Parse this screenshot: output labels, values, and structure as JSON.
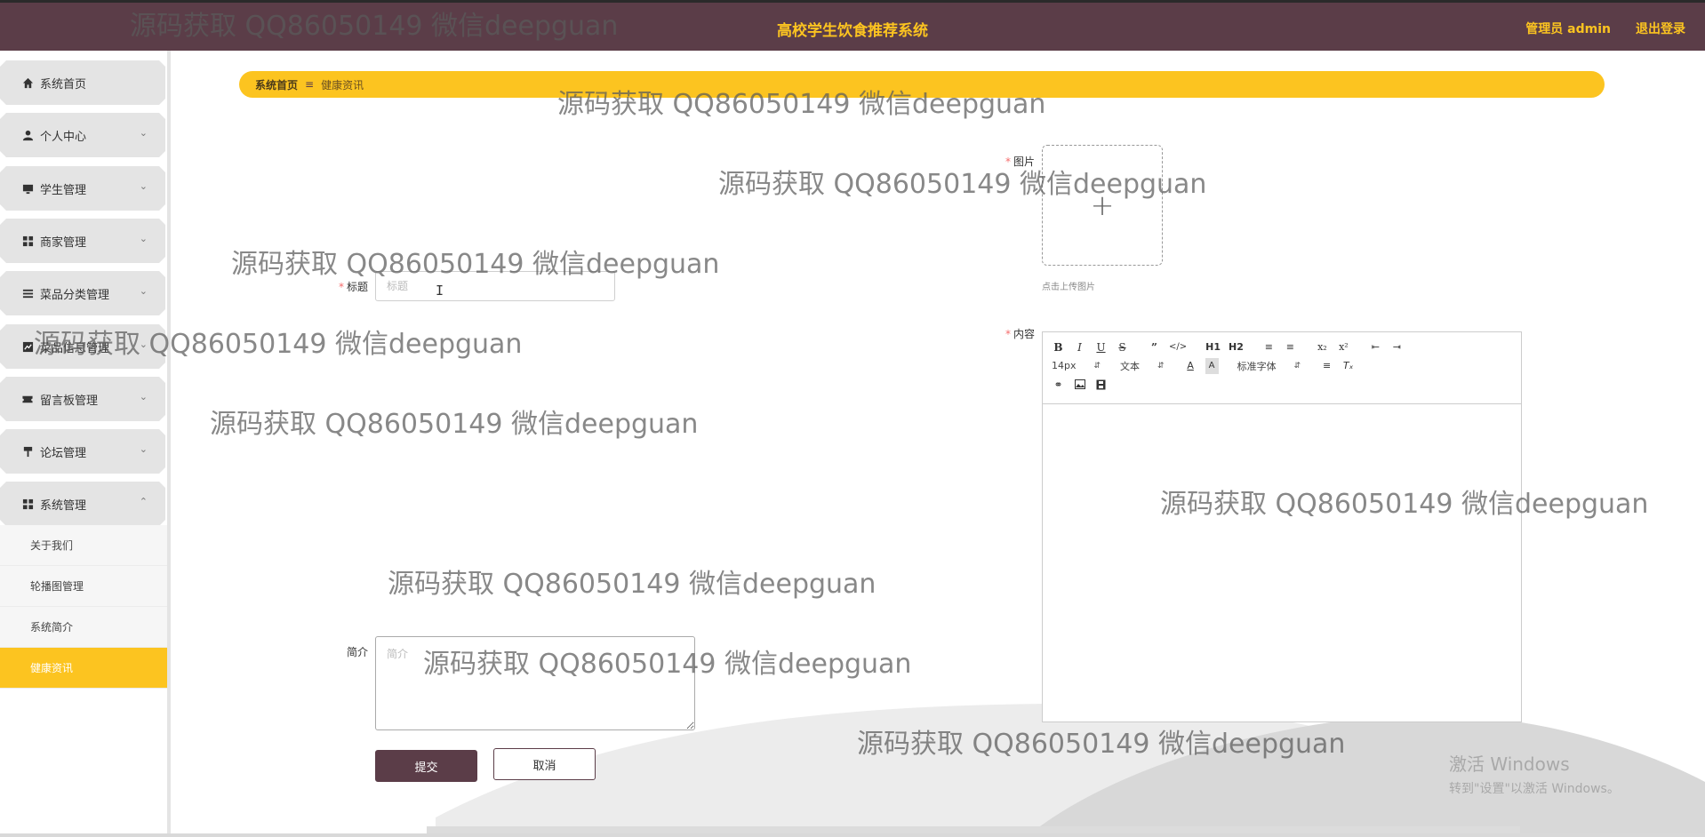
{
  "header": {
    "app_title": "高校学生饮食推荐系统",
    "user_label": "管理员 admin",
    "logout_label": "退出登录"
  },
  "sidebar": {
    "items": [
      {
        "label": "系统首页",
        "icon": "home-icon",
        "expandable": false
      },
      {
        "label": "个人中心",
        "icon": "user-icon",
        "expandable": true
      },
      {
        "label": "学生管理",
        "icon": "monitor-icon",
        "expandable": true
      },
      {
        "label": "商家管理",
        "icon": "grid-icon",
        "expandable": true
      },
      {
        "label": "菜品分类管理",
        "icon": "list-icon",
        "expandable": true
      },
      {
        "label": "菜品信息管理",
        "icon": "chart-icon",
        "expandable": true
      },
      {
        "label": "留言板管理",
        "icon": "ticket-icon",
        "expandable": true
      },
      {
        "label": "论坛管理",
        "icon": "pin-icon",
        "expandable": true
      },
      {
        "label": "系统管理",
        "icon": "grid-icon",
        "expandable": true,
        "expanded": true
      }
    ],
    "sub_items": [
      {
        "label": "关于我们",
        "active": false
      },
      {
        "label": "轮播图管理",
        "active": false
      },
      {
        "label": "系统简介",
        "active": false
      },
      {
        "label": "健康资讯",
        "active": true
      }
    ]
  },
  "breadcrumb": {
    "home": "系统首页",
    "separator_icon": "menu-icon",
    "current": "健康资讯"
  },
  "form": {
    "title_label": "标题",
    "title_placeholder": "标题",
    "image_label": "图片",
    "upload_hint": "点击上传图片",
    "content_label": "内容",
    "intro_label": "简介",
    "intro_placeholder": "简介",
    "submit_label": "提交",
    "cancel_label": "取消"
  },
  "editor": {
    "font_size": "14px",
    "paragraph": "文本",
    "font_family": "标准字体",
    "h1": "H1",
    "h2": "H2"
  },
  "watermark": "源码获取 QQ86050149 微信deepguan",
  "windows_activation": {
    "line1": "激活 Windows",
    "line2": "转到\"设置\"以激活 Windows。"
  },
  "colors": {
    "header_bg": "#5b3d48",
    "accent_yellow": "#fcc420",
    "menu_bg": "#e4e4e4",
    "required": "#f56c6c"
  }
}
